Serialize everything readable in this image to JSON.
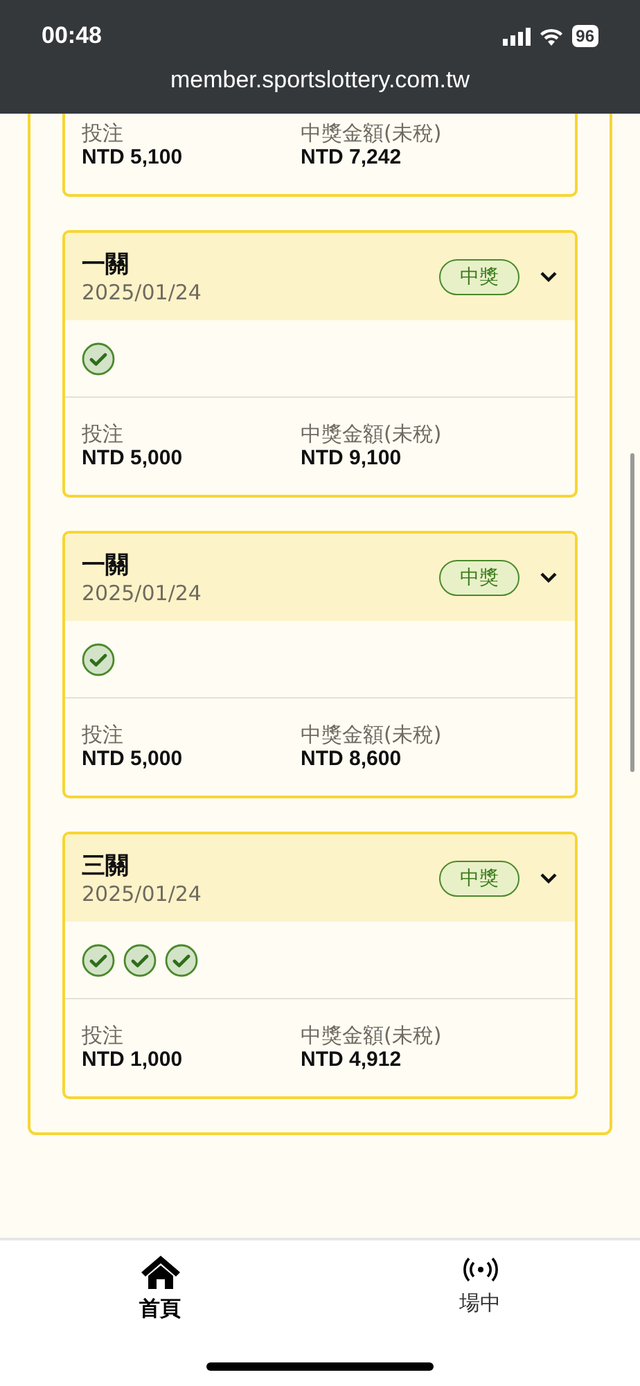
{
  "status_bar": {
    "time": "00:48",
    "battery": "96"
  },
  "address_bar": {
    "url": "member.sportslottery.com.tw"
  },
  "partial_card": {
    "stake_label": "投注",
    "stake": "NTD 5,100",
    "payout_label": "中獎金額(未稅)",
    "payout": "NTD 7,242"
  },
  "cards": [
    {
      "title": "一關",
      "date": "2025/01/24",
      "badge": "中獎",
      "expanded": false,
      "legs": [
        {
          "won": true
        }
      ],
      "stake_label": "投注",
      "stake": "NTD 5,000",
      "payout_label": "中獎金額(未稅)",
      "payout": "NTD 9,100"
    },
    {
      "title": "一關",
      "date": "2025/01/24",
      "badge": "中獎",
      "expanded": false,
      "legs": [
        {
          "won": true
        }
      ],
      "stake_label": "投注",
      "stake": "NTD 5,000",
      "payout_label": "中獎金額(未稅)",
      "payout": "NTD 8,600"
    },
    {
      "title": "三關",
      "date": "2025/01/24",
      "badge": "中獎",
      "expanded": false,
      "legs": [
        {
          "won": true
        },
        {
          "won": true
        },
        {
          "won": true
        }
      ],
      "stake_label": "投注",
      "stake": "NTD 1,000",
      "payout_label": "中獎金額(未稅)",
      "payout": "NTD 4,912"
    }
  ],
  "bottom_nav": [
    {
      "kind": "home",
      "label": "首頁",
      "selected": true
    },
    {
      "kind": "live",
      "label": "場中",
      "selected": false
    }
  ]
}
